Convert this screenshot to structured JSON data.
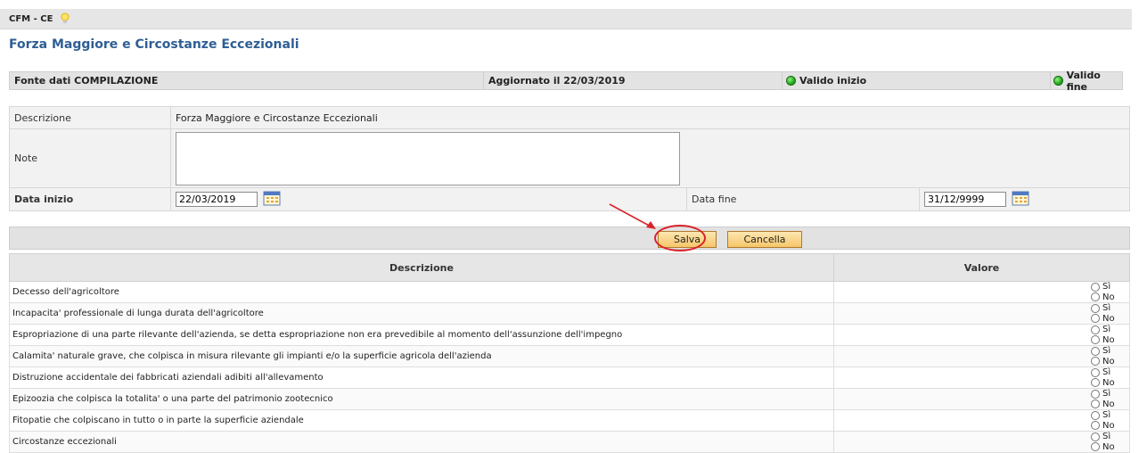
{
  "header": {
    "app_code": "CFM - CE",
    "title": "Forza Maggiore e Circostanze Eccezionali"
  },
  "info": {
    "fonte": "Fonte dati COMPILAZIONE",
    "aggiornato": "Aggiornato il 22/03/2019",
    "valido_inizio": "Valido inizio",
    "valido_fine": "Valido fine",
    "status_color": "#22a81c"
  },
  "form": {
    "descrizione_label": "Descrizione",
    "descrizione_value": "Forza Maggiore e Circostanze Eccezionali",
    "note_label": "Note",
    "note_value": "",
    "data_inizio_label": "Data inizio",
    "data_inizio_value": "22/03/2019",
    "data_fine_label": "Data fine",
    "data_fine_value": "31/12/9999"
  },
  "buttons": {
    "salva": "Salva",
    "cancella": "Cancella"
  },
  "table": {
    "col_descrizione": "Descrizione",
    "col_valore": "Valore",
    "opt_si": "Sì",
    "opt_no": "No",
    "rows": [
      "Decesso dell'agricoltore",
      "Incapacita' professionale di lunga durata dell'agricoltore",
      "Espropriazione di una parte rilevante dell'azienda, se detta espropriazione non era prevedibile al momento dell'assunzione dell'impegno",
      "Calamita' naturale grave, che colpisca in misura rilevante gli impianti e/o la superficie agricola dell'azienda",
      "Distruzione accidentale dei fabbricati aziendali adibiti all'allevamento",
      "Epizoozia che colpisca la totalita' o una parte del patrimonio zootecnico",
      "Fitopatie che colpiscano in tutto o in parte la superficie aziendale",
      "Circostanze eccezionali"
    ]
  }
}
